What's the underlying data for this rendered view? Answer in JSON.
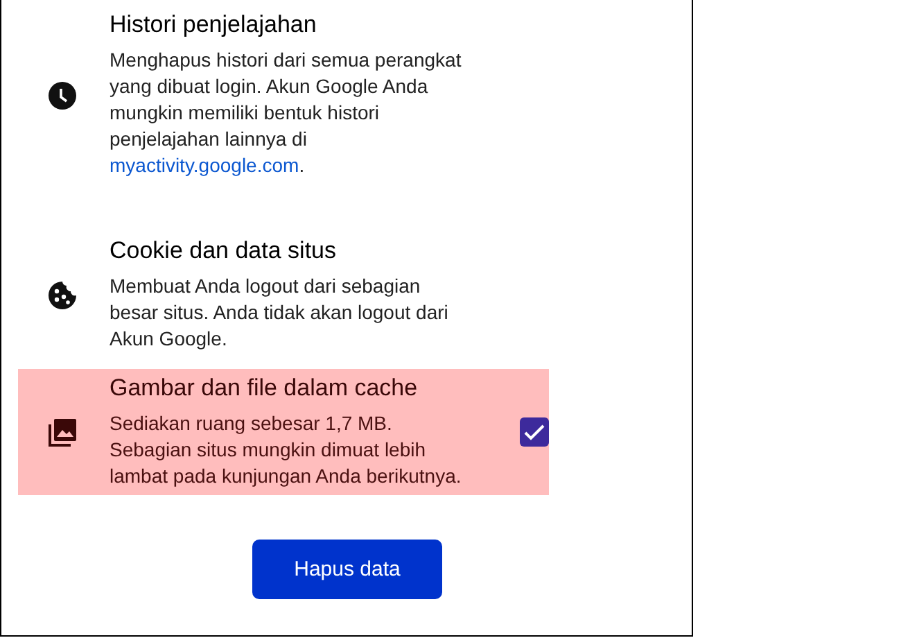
{
  "items": [
    {
      "kind": "history",
      "title": "Histori penjelajahan",
      "description": "Menghapus histori dari semua perangkat yang dibuat login. Akun Google Anda mungkin memiliki bentuk histori penjelajahan lainnya di",
      "link": "myactivity.google.com",
      "after": ".",
      "checked": false
    },
    {
      "kind": "cookie",
      "title": "Cookie dan data situs",
      "description": "Membuat Anda logout dari sebagian besar situs. Anda tidak akan logout dari Akun Google.",
      "checked": false
    },
    {
      "kind": "images",
      "title": "Gambar dan file dalam cache",
      "description": "Sediakan ruang sebesar 1,7 MB. Sebagian situs mungkin dimuat lebih lambat pada kunjungan Anda berikutnya.",
      "checked": true
    }
  ],
  "button": "Hapus data"
}
